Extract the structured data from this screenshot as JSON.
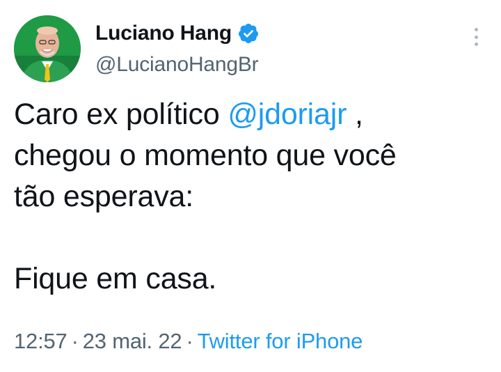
{
  "author": {
    "display_name": "Luciano Hang",
    "handle": "@LucianoHangBr",
    "verified_icon": "verified-badge-icon",
    "avatar_icon": "profile-photo"
  },
  "tweet": {
    "line1_prefix": "Caro ex político ",
    "mention": "@jdoriajr",
    "line1_suffix": " ,",
    "line2": "chegou o momento que você",
    "line3": "tão esperava:",
    "line4": "Fique em casa."
  },
  "meta": {
    "time": "12:57",
    "separator": "·",
    "date": "23 mai. 22",
    "source": "Twitter for iPhone"
  },
  "colors": {
    "link": "#1d9bf0",
    "secondary_text": "#536471",
    "verified": "#1d9bf0"
  }
}
